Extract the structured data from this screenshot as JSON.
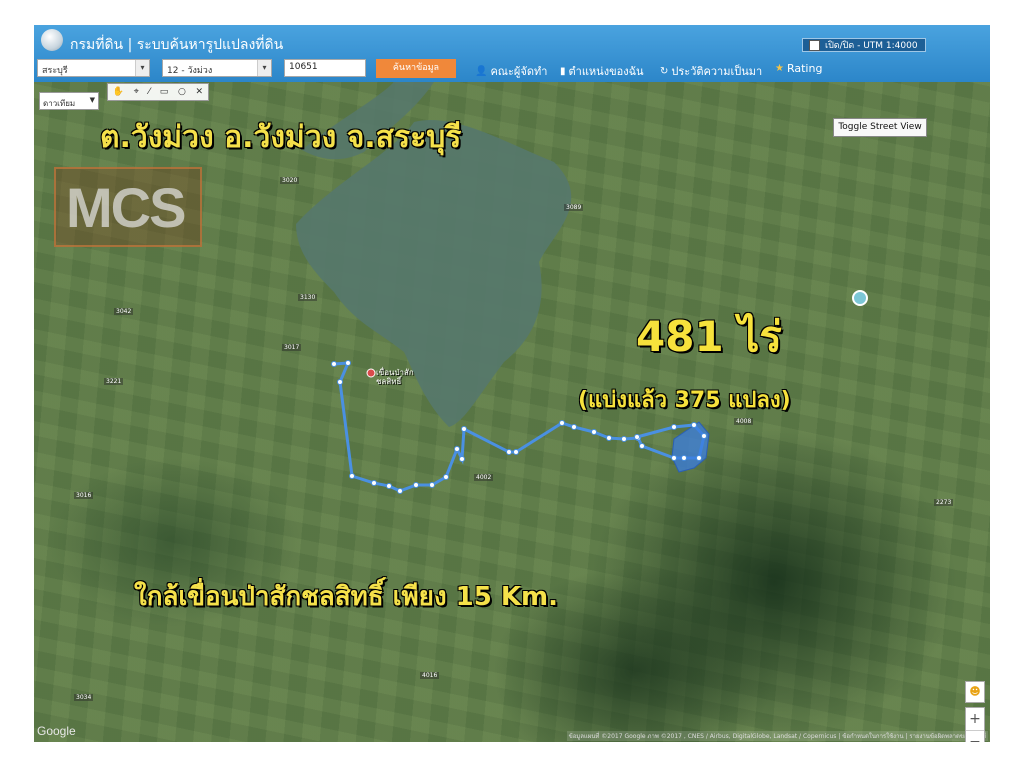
{
  "header": {
    "title": "กรมที่ดิน | ระบบค้นหารูปแปลงที่ดิน",
    "utm_toggle_label": "เปิด/ปิด - UTM 1:4000",
    "province": "สระบุรี",
    "district": "12 - วังม่วง",
    "parcel_number": "10651",
    "search_label": "ค้นหาข้อมูล",
    "nav": [
      {
        "label": "คณะผู้จัดทำ",
        "icon": "users-icon"
      },
      {
        "label": "ตำแหน่งของฉัน",
        "icon": "location-icon"
      },
      {
        "label": "ประวัติความเป็นมา",
        "icon": "history-icon"
      },
      {
        "label": "Rating",
        "icon": "star-icon"
      }
    ]
  },
  "map": {
    "layer_select": "ดาวเทียม",
    "street_view_label": "Toggle Street View",
    "watermark": "MCS",
    "caption_location": "ต.วังม่วง อ.วังม่วง จ.สระบุรี",
    "caption_area": "481 ไร่",
    "caption_plots": "(แบ่งแล้ว 375 แปลง)",
    "caption_distance": "ใกล้เขื่อนป่าสักชลสิทธิ์ เพียง 15 Km.",
    "dam_label": "เขื่อนป่าสัก ชลสิทธิ์",
    "google_label": "Google",
    "attribution": "ข้อมูลแผนที่ ©2017 Google ภาพ ©2017 , CNES / Airbus, DigitalGlobe, Landsat / Copernicus | ข้อกำหนดในการใช้งาน | รายงานข้อผิดพลาดของแผนที่",
    "route_color": "#4a90e2",
    "parcel_color": "#3b7de0",
    "road_tags": [
      "3017",
      "3020",
      "3130",
      "3221",
      "3042",
      "3089",
      "3034",
      "4016",
      "4002",
      "4008",
      "2273",
      "3016"
    ]
  }
}
